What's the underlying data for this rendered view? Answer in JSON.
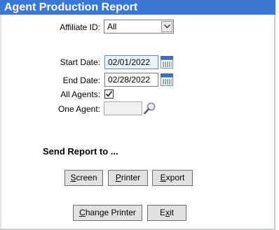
{
  "window": {
    "title": "Agent Production Report"
  },
  "form": {
    "affiliate_label": "Affiliate ID:",
    "affiliate_value": "All",
    "start_label": "Start Date:",
    "start_value": "02/01/2022",
    "end_label": "End Date:",
    "end_value": "02/28/2022",
    "all_agents_label": "All Agents:",
    "all_agents_checked": true,
    "one_agent_label": "One Agent:",
    "one_agent_value": ""
  },
  "send": {
    "title": "Send Report to ...",
    "screen": {
      "accel": "S",
      "rest": "creen"
    },
    "printer": {
      "accel": "P",
      "rest": "rinter"
    },
    "export": {
      "accel": "E",
      "rest": "xport"
    }
  },
  "footer": {
    "change_printer": {
      "accel": "C",
      "rest": "hange Printer"
    },
    "exit": {
      "pre": "E",
      "accel": "x",
      "rest": "it"
    }
  },
  "colors": {
    "titlebar": "#3a78d6",
    "calendar": "#3b6fc2"
  },
  "icons": [
    "chevron-down-icon",
    "calendar-icon",
    "magnifier-icon",
    "checkmark-icon"
  ]
}
